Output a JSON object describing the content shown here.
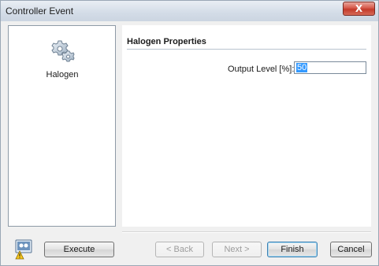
{
  "window": {
    "title": "Controller Event",
    "close_glyph": "X"
  },
  "left_panel": {
    "items": [
      {
        "label": "Halogen",
        "icon": "gear-icon"
      }
    ]
  },
  "properties": {
    "section_title": "Halogen Properties",
    "field": {
      "label": "Output Level [%]:",
      "value": "50"
    }
  },
  "footer": {
    "execute_label": "Execute",
    "back_label": "< Back",
    "next_label": "Next >",
    "finish_label": "Finish",
    "cancel_label": "Cancel",
    "status_icon": "device-warning-icon"
  },
  "colors": {
    "selection": "#3399ff",
    "close_button": "#c33a2a",
    "title_bar": "#d3dce7"
  }
}
